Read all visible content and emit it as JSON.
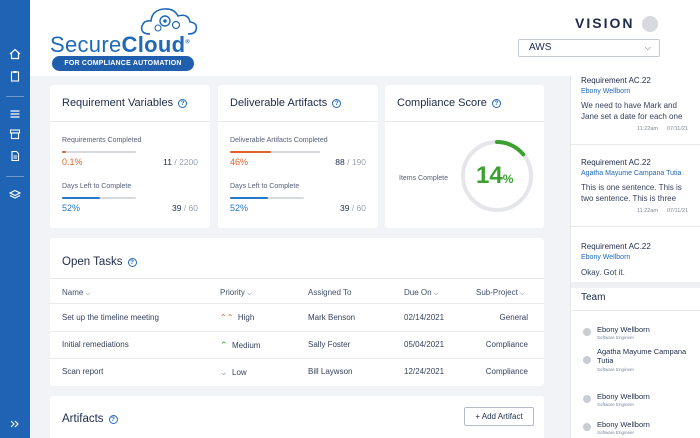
{
  "brand": {
    "name_part1": "Secure",
    "name_part2": "Cloud",
    "registered": "®",
    "tagline": "FOR COMPLIANCE AUTOMATION"
  },
  "header": {
    "vision_label": "VISION",
    "provider_select": "AWS"
  },
  "sidebar": {
    "icons": [
      "home-icon",
      "clipboard-icon",
      "list-icon",
      "archive-icon",
      "document-icon",
      "layers-icon",
      "expand-icon"
    ]
  },
  "requirement_variables": {
    "title": "Requirement Variables",
    "metrics": [
      {
        "label": "Requirements Completed",
        "percent_text": "0.1%",
        "value": "11",
        "total": "2200",
        "fill": 0.06,
        "color": "#e0622a"
      },
      {
        "label": "Days Left to Complete",
        "percent_text": "52%",
        "value": "39",
        "total": "60",
        "fill": 0.52,
        "color": "#2677c8"
      }
    ]
  },
  "deliverable_artifacts": {
    "title": "Deliverable Artifacts",
    "metrics": [
      {
        "label": "Deliverable Artifacts Completed",
        "percent_text": "46%",
        "value": "88",
        "total": "190",
        "fill": 0.46,
        "color": "#e0622a"
      },
      {
        "label": "Days Left to Complete",
        "percent_text": "52%",
        "value": "39",
        "total": "60",
        "fill": 0.52,
        "color": "#2677c8"
      }
    ]
  },
  "compliance_score": {
    "title": "Compliance Score",
    "caption": "Items Complete",
    "value_number": "14",
    "value_unit": "%",
    "fraction": 0.14,
    "color": "#3aa12f"
  },
  "open_tasks": {
    "title": "Open Tasks",
    "columns": [
      "Name",
      "Priority",
      "Assigned To",
      "Due On",
      "Sub-Project"
    ],
    "rows": [
      {
        "name": "Set up the timeline meeting",
        "priority": "High",
        "priority_icon": "double-chevron-up-icon",
        "priority_color": "#e0622a",
        "assigned": "Mark Benson",
        "due": "02/14/2021",
        "subproject": "General"
      },
      {
        "name": "Initial remediations",
        "priority": "Medium",
        "priority_icon": "chevron-up-icon",
        "priority_color": "#3aa12f",
        "assigned": "Sally Foster",
        "due": "05/04/2021",
        "subproject": "Compliance"
      },
      {
        "name": "Scan report",
        "priority": "Low",
        "priority_icon": "chevron-down-icon",
        "priority_color": "#9aa2b1",
        "assigned": "Bill Laywson",
        "due": "12/24/2021",
        "subproject": "Compliance"
      }
    ]
  },
  "artifacts": {
    "title": "Artifacts",
    "add_label": "+ Add Artifact"
  },
  "messages": [
    {
      "title": "Requirement AC.22",
      "author": "Ebony Wellborn",
      "body": "We need to have Mark and Jane set a date for each one",
      "time": "11:22am",
      "date": "07/11/21"
    },
    {
      "title": "Requirement AC.22",
      "author": "Agatha Mayume Campana Tutia",
      "body": "This is one sentence. This is two sentence. This is three",
      "time": "11:22am",
      "date": "07/11/21"
    },
    {
      "title": "Requirement AC.22",
      "author": "Ebony Wellborn",
      "body": "Okay. Got it.",
      "time": "",
      "date": ""
    }
  ],
  "team": {
    "title": "Team",
    "members": [
      {
        "name": "Ebony Wellborn",
        "role": "Software Engineer"
      },
      {
        "name": "Agatha Mayume Campana Tutia",
        "role": "Software Engineer"
      },
      {
        "name": "Ebony Wellborn",
        "role": "Software Engineer"
      },
      {
        "name": "Ebony Wellborn",
        "role": "Software Engineer"
      }
    ]
  }
}
